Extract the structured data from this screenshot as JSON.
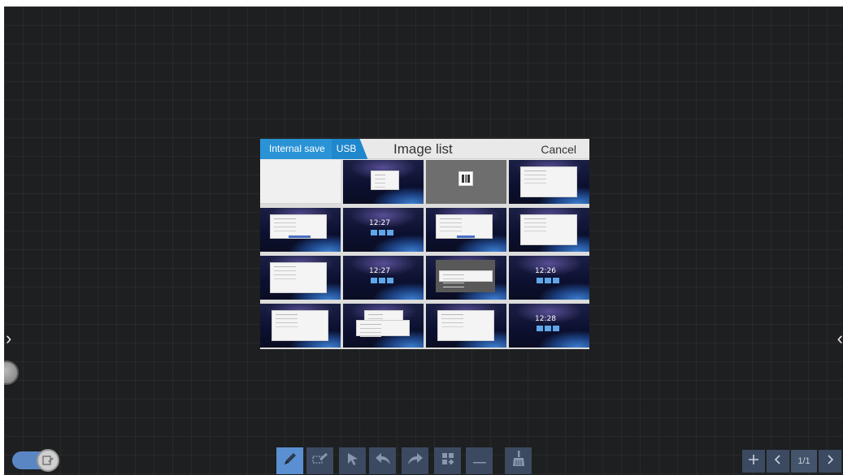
{
  "dialog": {
    "tabs": [
      {
        "label": "Internal save"
      },
      {
        "label": "USB"
      }
    ],
    "title": "Image list",
    "cancel_label": "Cancel",
    "thumbnails": [
      {
        "kind": "blank"
      },
      {
        "kind": "screen-window"
      },
      {
        "kind": "qr-code"
      },
      {
        "kind": "screen-window"
      },
      {
        "kind": "screen-window"
      },
      {
        "kind": "home-clock",
        "clock": "12:27"
      },
      {
        "kind": "screen-window"
      },
      {
        "kind": "screen-window"
      },
      {
        "kind": "screen-window"
      },
      {
        "kind": "home-clock",
        "clock": "12:27"
      },
      {
        "kind": "screen-dialog"
      },
      {
        "kind": "home-clock",
        "clock": "12:26"
      },
      {
        "kind": "screen-window"
      },
      {
        "kind": "screen-browser"
      },
      {
        "kind": "screen-window"
      },
      {
        "kind": "home-clock",
        "clock": "12:28"
      }
    ]
  },
  "toolbar": {
    "tools": [
      {
        "name": "pen",
        "icon": "pen-icon",
        "active": true
      },
      {
        "name": "eraser",
        "icon": "eraser-icon"
      },
      {
        "name": "select",
        "icon": "select-arrow-icon"
      },
      {
        "name": "undo",
        "icon": "undo-icon"
      },
      {
        "name": "redo",
        "icon": "redo-icon"
      },
      {
        "name": "menu",
        "icon": "grid-menu-icon"
      },
      {
        "name": "line",
        "icon": "line-icon"
      },
      {
        "name": "clear",
        "icon": "broom-icon"
      }
    ],
    "pager": {
      "add_icon": "plus-icon",
      "prev_icon": "chevron-left-icon",
      "page_indicator": "1/1",
      "next_icon": "chevron-right-icon"
    }
  },
  "side": {
    "left_arrow": "›",
    "right_arrow": "‹"
  },
  "colors": {
    "board_bg": "#1e1f20",
    "accent": "#2a93d5",
    "toolbar_btn": "#3b4a60",
    "toolbar_active": "#5a8fd1"
  }
}
